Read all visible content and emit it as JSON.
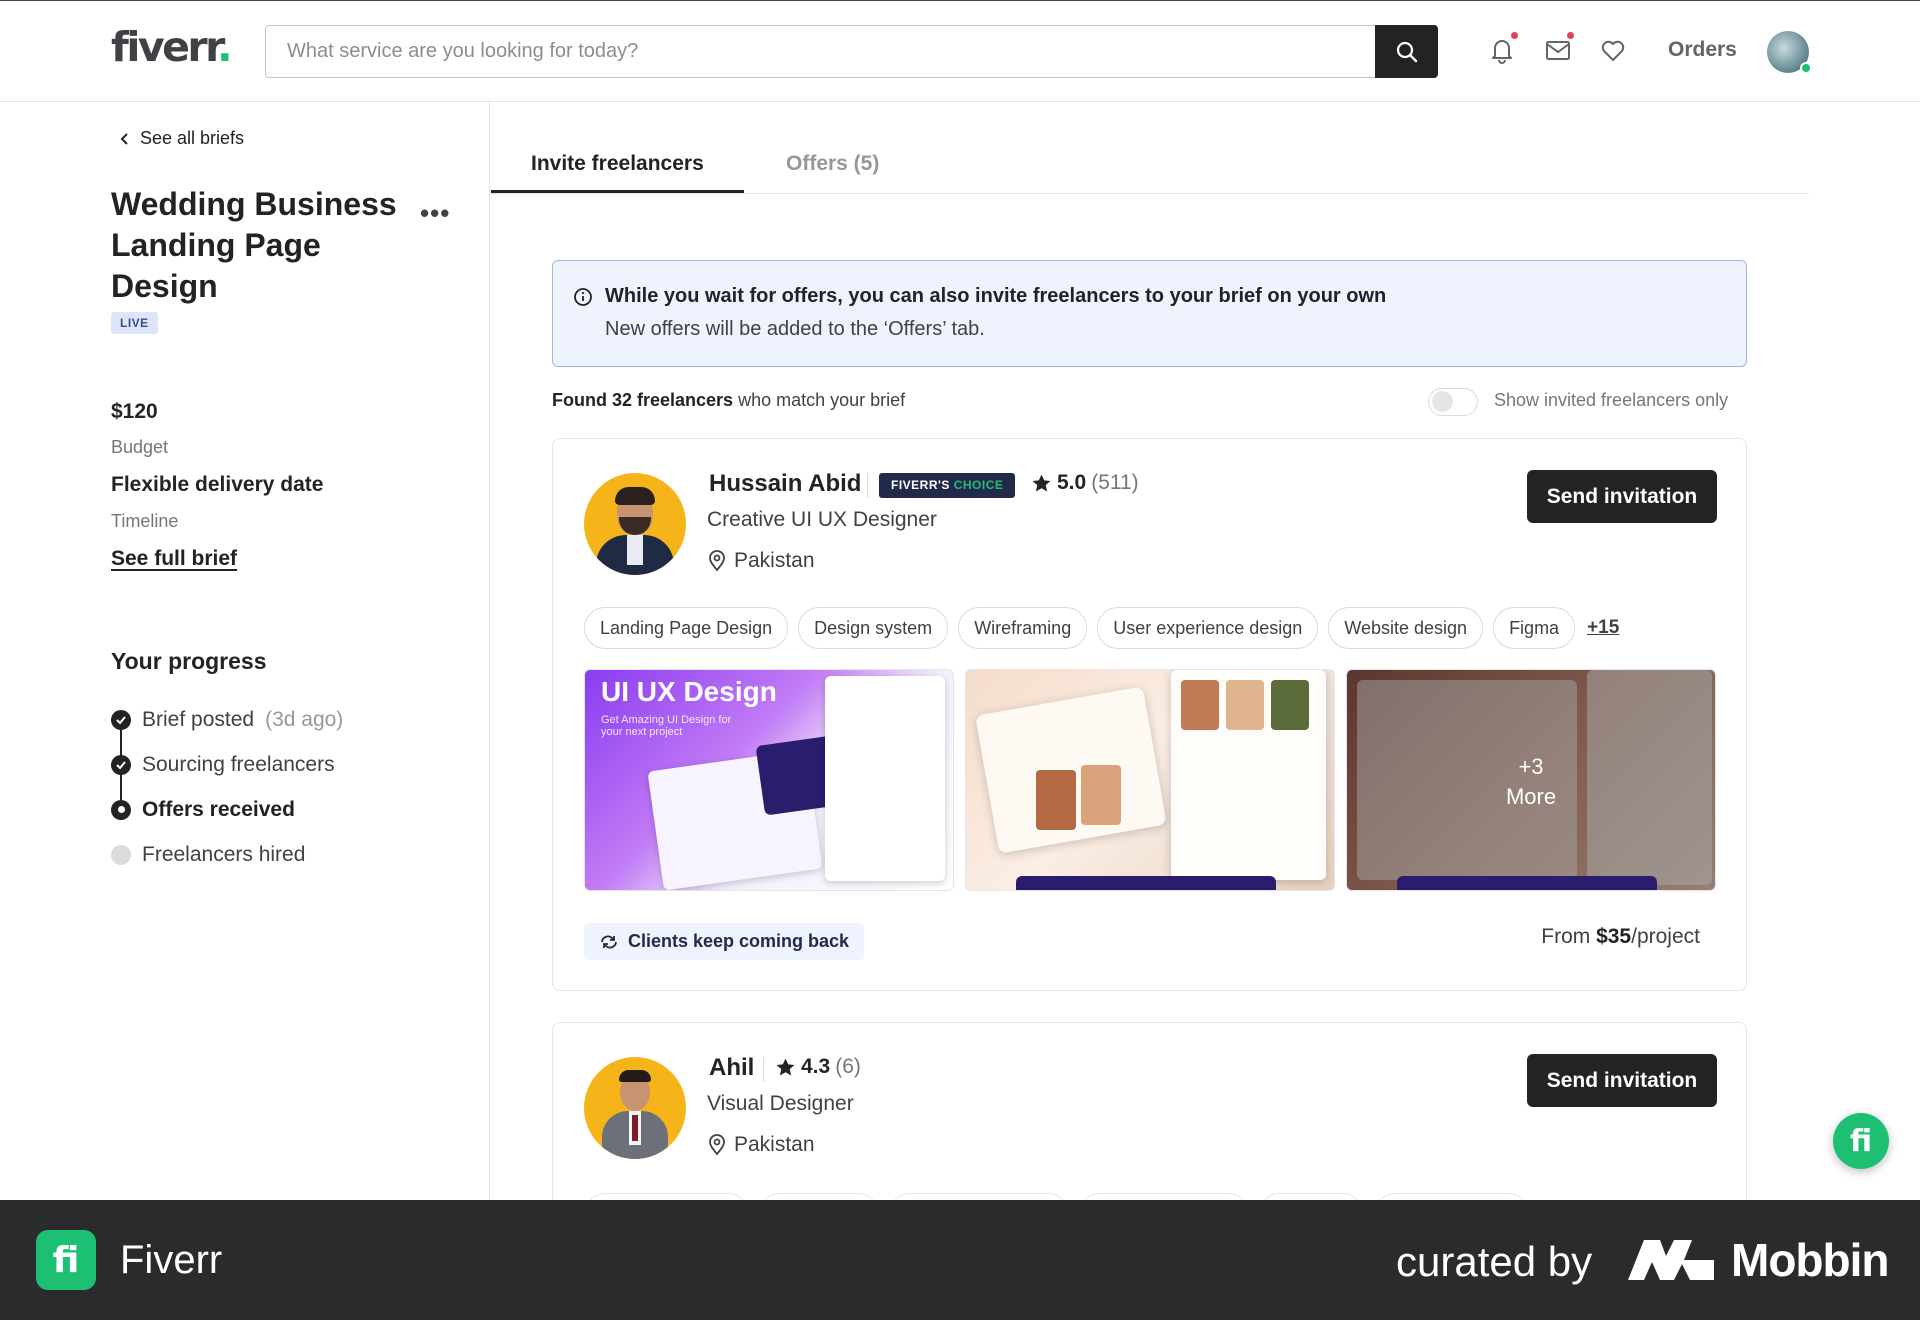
{
  "header": {
    "logo": "fiverr",
    "logo_dot": ".",
    "search_placeholder": "What service are you looking for today?",
    "orders_label": "Orders"
  },
  "sidebar": {
    "back_label": "See all briefs",
    "brief_title": "Wedding Business Landing Page Design",
    "status_badge": "LIVE",
    "budget_value": "$120",
    "budget_label": "Budget",
    "timeline_value": "Flexible delivery date",
    "timeline_label": "Timeline",
    "full_brief_link": "See full brief",
    "progress_title": "Your progress",
    "steps": [
      {
        "label": "Brief posted",
        "note": "(3d ago)",
        "state": "done"
      },
      {
        "label": "Sourcing freelancers",
        "note": "",
        "state": "done"
      },
      {
        "label": "Offers received",
        "note": "",
        "state": "current"
      },
      {
        "label": "Freelancers hired",
        "note": "",
        "state": "todo"
      }
    ]
  },
  "tabs": [
    {
      "label": "Invite freelancers",
      "active": true
    },
    {
      "label": "Offers (5)",
      "active": false
    }
  ],
  "info": {
    "line1": "While you wait for offers, you can also invite freelancers to your brief on your own",
    "line2": "New offers will be added to the ‘Offers’ tab."
  },
  "results": {
    "found_bold": "Found 32 freelancers",
    "found_rest": " who match your brief",
    "toggle_label": "Show invited freelancers only",
    "toggle_on": false
  },
  "freelancers": [
    {
      "name": "Hussain Abid",
      "badge_part1": "FIVERR'S",
      "badge_part2": "CHOICE",
      "rating": "5.0",
      "reviews": "(511)",
      "role": "Creative UI UX Designer",
      "location": "Pakistan",
      "button": "Send invitation",
      "tags": [
        "Landing Page Design",
        "Design system",
        "Wireframing",
        "User experience design",
        "Website design",
        "Figma"
      ],
      "more_tags": "+15",
      "gallery": {
        "thumb1_title": "UI UX Design",
        "thumb1_sub": "Get Amazing UI Design for your next project",
        "thumb3_count": "+3",
        "thumb3_more": "More"
      },
      "highlight": "Clients keep coming back",
      "price_prefix": "From ",
      "price": "$35",
      "price_unit": "/project"
    },
    {
      "name": "Ahil",
      "rating": "4.3",
      "reviews": "(6)",
      "role": "Visual Designer",
      "location": "Pakistan",
      "button": "Send invitation"
    }
  ],
  "footer": {
    "app_name": "Fiverr",
    "curated_by": "curated by",
    "brand": "Mobbin"
  },
  "colors": {
    "brand_green": "#1dbf73",
    "dark": "#222325",
    "info_bg": "#eef3fd"
  }
}
